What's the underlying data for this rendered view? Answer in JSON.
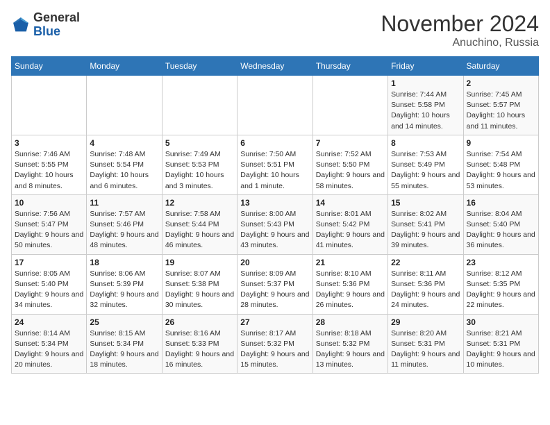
{
  "header": {
    "logo_general": "General",
    "logo_blue": "Blue",
    "month_title": "November 2024",
    "location": "Anuchino, Russia"
  },
  "weekdays": [
    "Sunday",
    "Monday",
    "Tuesday",
    "Wednesday",
    "Thursday",
    "Friday",
    "Saturday"
  ],
  "weeks": [
    [
      {
        "day": "",
        "info": ""
      },
      {
        "day": "",
        "info": ""
      },
      {
        "day": "",
        "info": ""
      },
      {
        "day": "",
        "info": ""
      },
      {
        "day": "",
        "info": ""
      },
      {
        "day": "1",
        "info": "Sunrise: 7:44 AM\nSunset: 5:58 PM\nDaylight: 10 hours and 14 minutes."
      },
      {
        "day": "2",
        "info": "Sunrise: 7:45 AM\nSunset: 5:57 PM\nDaylight: 10 hours and 11 minutes."
      }
    ],
    [
      {
        "day": "3",
        "info": "Sunrise: 7:46 AM\nSunset: 5:55 PM\nDaylight: 10 hours and 8 minutes."
      },
      {
        "day": "4",
        "info": "Sunrise: 7:48 AM\nSunset: 5:54 PM\nDaylight: 10 hours and 6 minutes."
      },
      {
        "day": "5",
        "info": "Sunrise: 7:49 AM\nSunset: 5:53 PM\nDaylight: 10 hours and 3 minutes."
      },
      {
        "day": "6",
        "info": "Sunrise: 7:50 AM\nSunset: 5:51 PM\nDaylight: 10 hours and 1 minute."
      },
      {
        "day": "7",
        "info": "Sunrise: 7:52 AM\nSunset: 5:50 PM\nDaylight: 9 hours and 58 minutes."
      },
      {
        "day": "8",
        "info": "Sunrise: 7:53 AM\nSunset: 5:49 PM\nDaylight: 9 hours and 55 minutes."
      },
      {
        "day": "9",
        "info": "Sunrise: 7:54 AM\nSunset: 5:48 PM\nDaylight: 9 hours and 53 minutes."
      }
    ],
    [
      {
        "day": "10",
        "info": "Sunrise: 7:56 AM\nSunset: 5:47 PM\nDaylight: 9 hours and 50 minutes."
      },
      {
        "day": "11",
        "info": "Sunrise: 7:57 AM\nSunset: 5:46 PM\nDaylight: 9 hours and 48 minutes."
      },
      {
        "day": "12",
        "info": "Sunrise: 7:58 AM\nSunset: 5:44 PM\nDaylight: 9 hours and 46 minutes."
      },
      {
        "day": "13",
        "info": "Sunrise: 8:00 AM\nSunset: 5:43 PM\nDaylight: 9 hours and 43 minutes."
      },
      {
        "day": "14",
        "info": "Sunrise: 8:01 AM\nSunset: 5:42 PM\nDaylight: 9 hours and 41 minutes."
      },
      {
        "day": "15",
        "info": "Sunrise: 8:02 AM\nSunset: 5:41 PM\nDaylight: 9 hours and 39 minutes."
      },
      {
        "day": "16",
        "info": "Sunrise: 8:04 AM\nSunset: 5:40 PM\nDaylight: 9 hours and 36 minutes."
      }
    ],
    [
      {
        "day": "17",
        "info": "Sunrise: 8:05 AM\nSunset: 5:40 PM\nDaylight: 9 hours and 34 minutes."
      },
      {
        "day": "18",
        "info": "Sunrise: 8:06 AM\nSunset: 5:39 PM\nDaylight: 9 hours and 32 minutes."
      },
      {
        "day": "19",
        "info": "Sunrise: 8:07 AM\nSunset: 5:38 PM\nDaylight: 9 hours and 30 minutes."
      },
      {
        "day": "20",
        "info": "Sunrise: 8:09 AM\nSunset: 5:37 PM\nDaylight: 9 hours and 28 minutes."
      },
      {
        "day": "21",
        "info": "Sunrise: 8:10 AM\nSunset: 5:36 PM\nDaylight: 9 hours and 26 minutes."
      },
      {
        "day": "22",
        "info": "Sunrise: 8:11 AM\nSunset: 5:36 PM\nDaylight: 9 hours and 24 minutes."
      },
      {
        "day": "23",
        "info": "Sunrise: 8:12 AM\nSunset: 5:35 PM\nDaylight: 9 hours and 22 minutes."
      }
    ],
    [
      {
        "day": "24",
        "info": "Sunrise: 8:14 AM\nSunset: 5:34 PM\nDaylight: 9 hours and 20 minutes."
      },
      {
        "day": "25",
        "info": "Sunrise: 8:15 AM\nSunset: 5:34 PM\nDaylight: 9 hours and 18 minutes."
      },
      {
        "day": "26",
        "info": "Sunrise: 8:16 AM\nSunset: 5:33 PM\nDaylight: 9 hours and 16 minutes."
      },
      {
        "day": "27",
        "info": "Sunrise: 8:17 AM\nSunset: 5:32 PM\nDaylight: 9 hours and 15 minutes."
      },
      {
        "day": "28",
        "info": "Sunrise: 8:18 AM\nSunset: 5:32 PM\nDaylight: 9 hours and 13 minutes."
      },
      {
        "day": "29",
        "info": "Sunrise: 8:20 AM\nSunset: 5:31 PM\nDaylight: 9 hours and 11 minutes."
      },
      {
        "day": "30",
        "info": "Sunrise: 8:21 AM\nSunset: 5:31 PM\nDaylight: 9 hours and 10 minutes."
      }
    ]
  ]
}
